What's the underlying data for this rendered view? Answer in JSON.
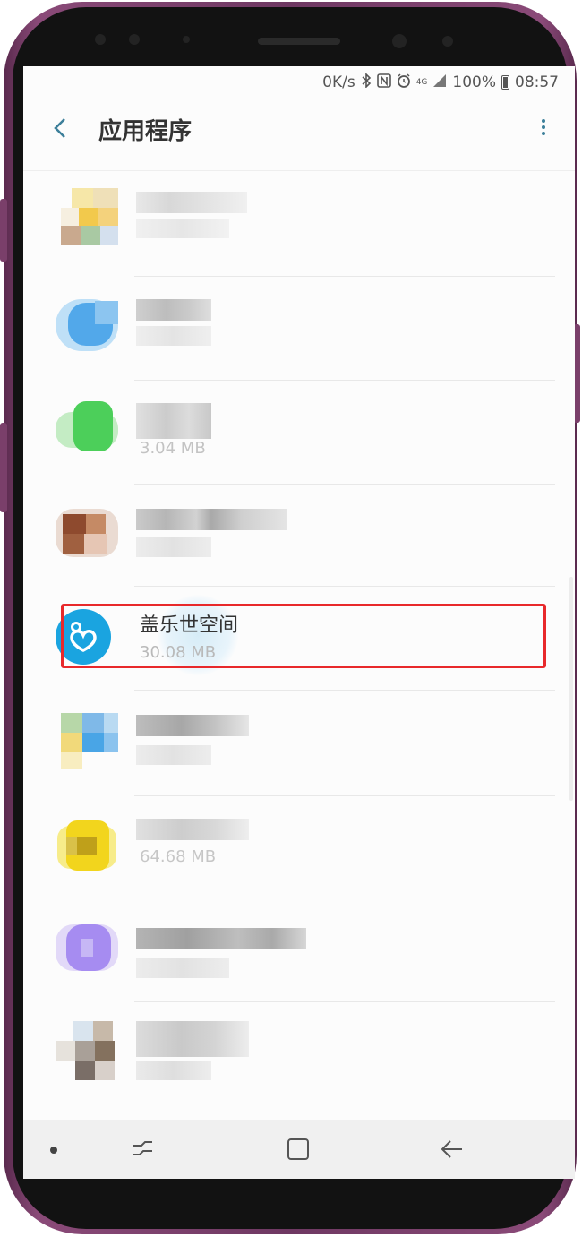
{
  "status_bar": {
    "network_speed": "0K/s",
    "bluetooth_icon": "bluetooth-icon",
    "nfc_icon": "nfc-icon",
    "alarm_icon": "alarm-icon",
    "signal_label": "4G",
    "battery": "100%",
    "time": "08:57"
  },
  "app_bar": {
    "title": "应用程序",
    "back_icon": "chevron-left-icon",
    "menu_icon": "more-vertical-icon"
  },
  "apps": [
    {
      "name": "",
      "size": ""
    },
    {
      "name": "",
      "size": ""
    },
    {
      "name": "",
      "size": "3.04 MB"
    },
    {
      "name": "",
      "size": ""
    },
    {
      "name": "盖乐世空间",
      "size": "30.08 MB",
      "highlighted": true
    },
    {
      "name": "",
      "size": ""
    },
    {
      "name": "",
      "size": "64.68 MB"
    },
    {
      "name": "",
      "size": ""
    },
    {
      "name": "",
      "size": ""
    }
  ],
  "nav_bar": {
    "recent_icon": "recent-apps-icon",
    "home_icon": "home-icon",
    "back_icon": "back-arrow-icon"
  },
  "colors": {
    "highlight_border": "#e8292b",
    "galaxy_space_icon": "#1aa4e0",
    "accent": "#3c7f9a"
  }
}
